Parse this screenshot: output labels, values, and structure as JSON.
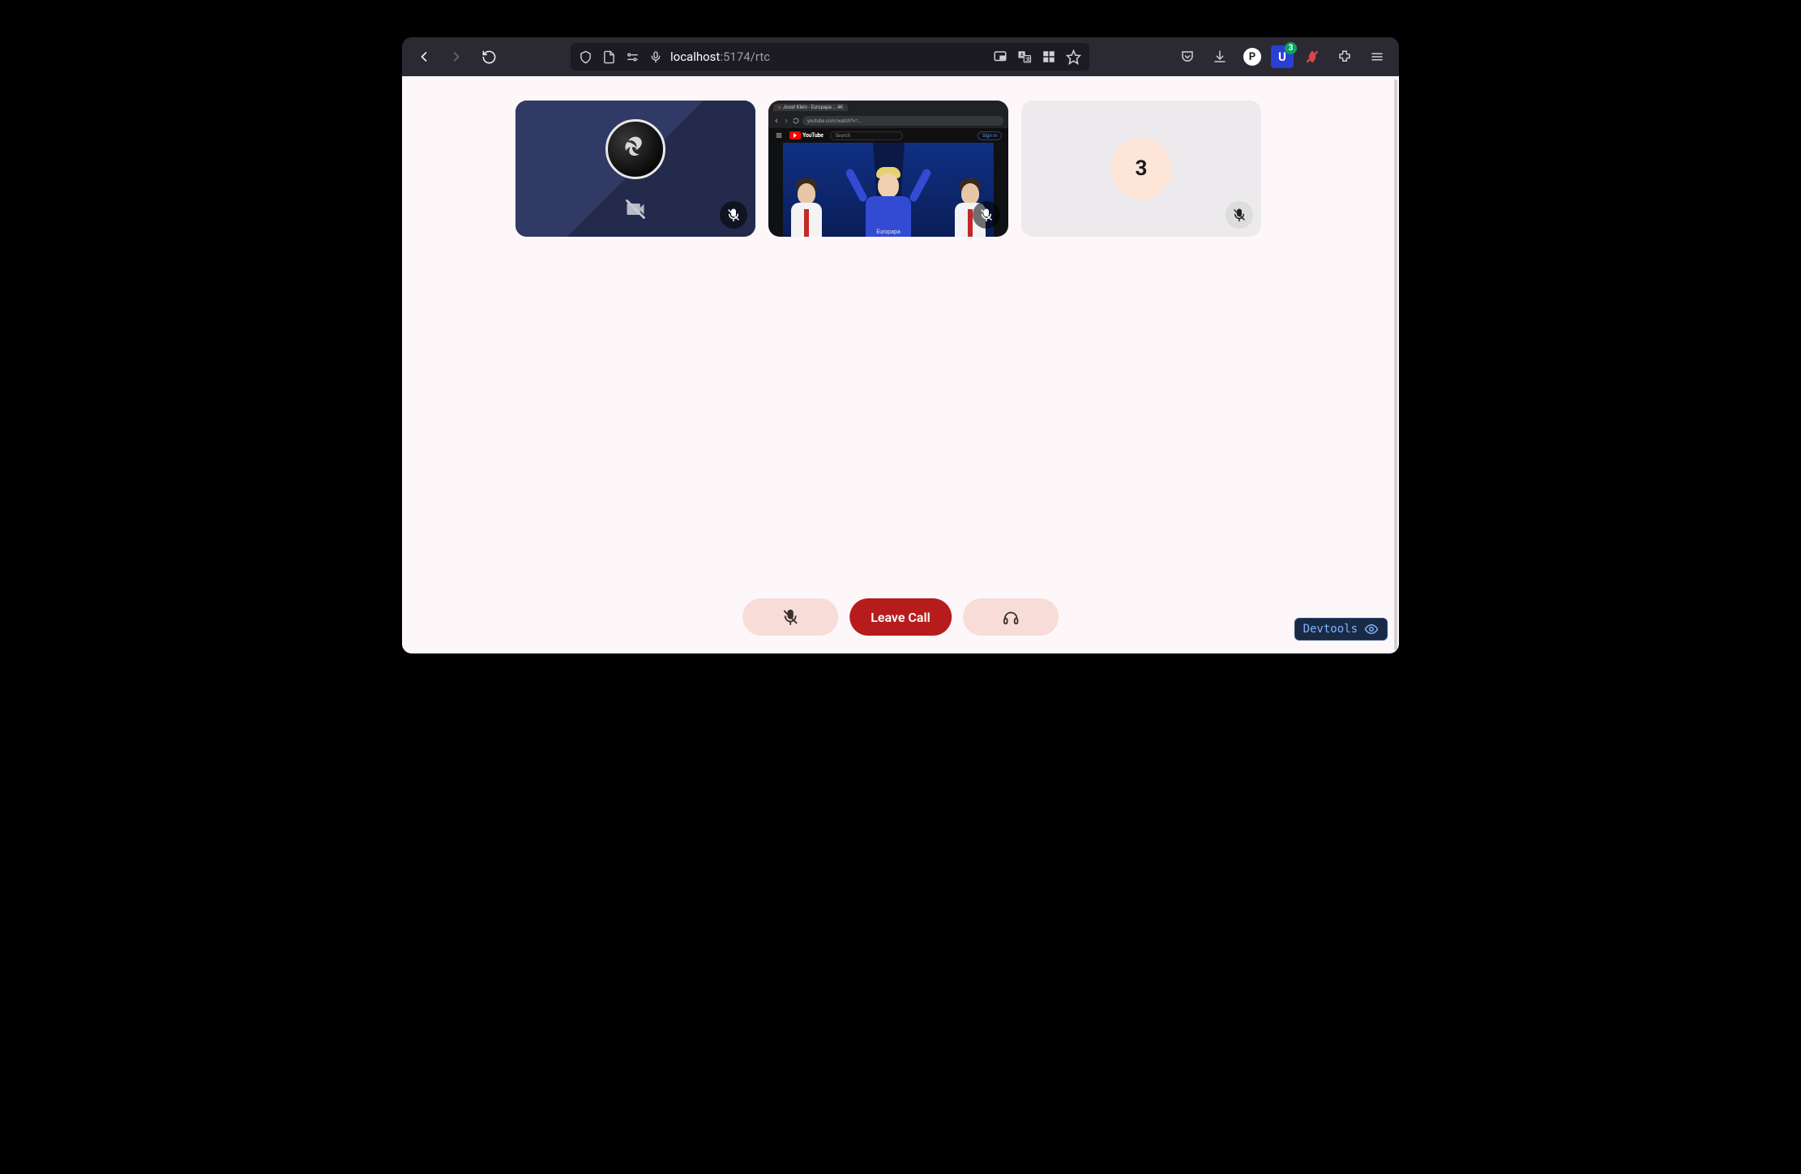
{
  "browser": {
    "url_host": "localhost",
    "url_rest": ":5174/rtc",
    "ext_u_count": "3"
  },
  "tiles": {
    "obs": {
      "caption": ""
    },
    "yt": {
      "tab_title": "Joost Klein - Europapa … 4K",
      "url": "youtube.com/watch?v=...",
      "logo_text": "YouTube",
      "search_placeholder": "Search",
      "sign_in": "Sign in",
      "video_caption": "Europapa"
    },
    "avatar": {
      "initial": "3"
    }
  },
  "controls": {
    "leave_label": "Leave Call"
  },
  "devtools": {
    "label": "Devtools"
  }
}
